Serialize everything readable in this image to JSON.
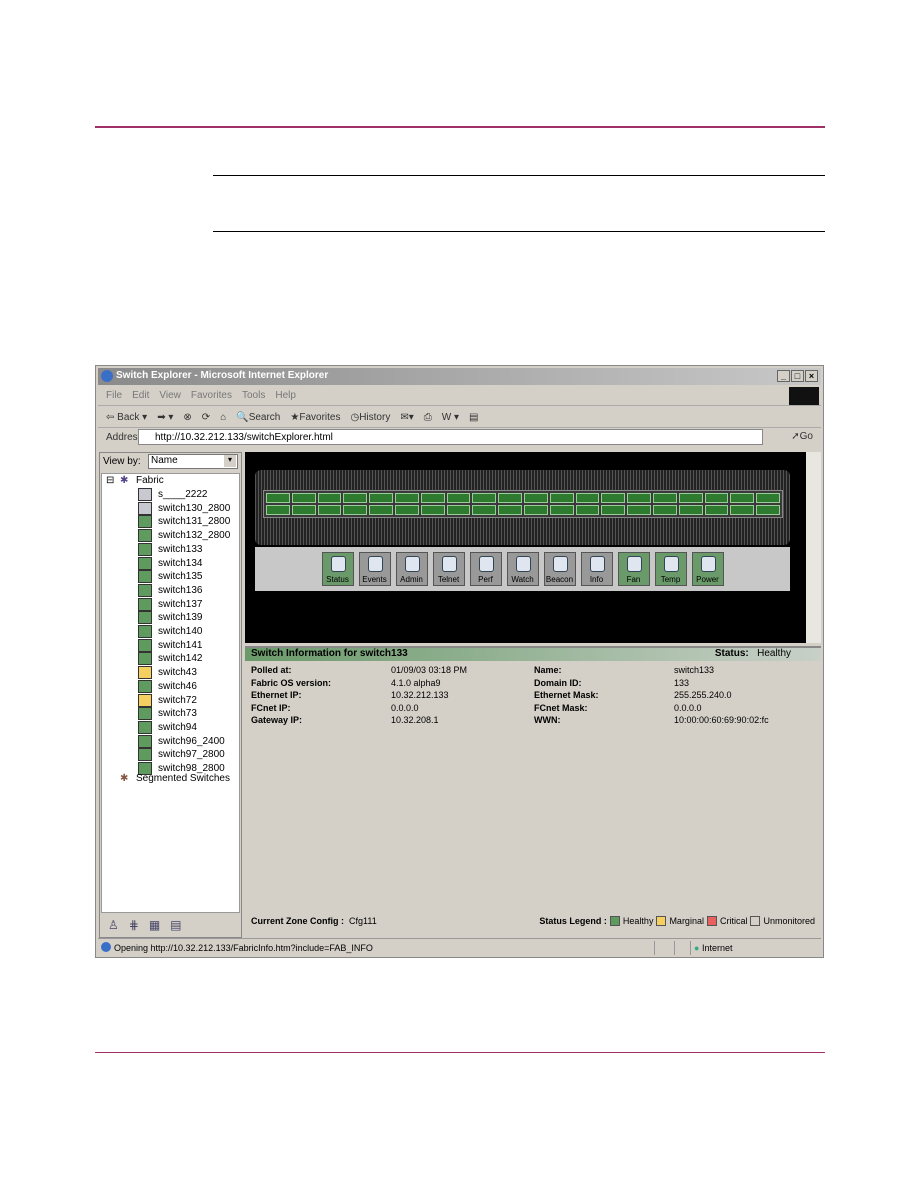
{
  "window": {
    "title": "Switch Explorer - Microsoft Internet Explorer"
  },
  "menu": [
    "File",
    "Edit",
    "View",
    "Favorites",
    "Tools",
    "Help"
  ],
  "toolbar": {
    "back": "Back",
    "search": "Search",
    "favorites": "Favorites",
    "history": "History"
  },
  "address": {
    "label": "Address",
    "url": "http://10.32.212.133/switchExplorer.html",
    "go": "Go"
  },
  "left": {
    "view_by_label": "View by:",
    "view_by_value": "Name",
    "root": "Fabric",
    "switches": [
      {
        "name": "s____2222",
        "status": "unmonitored"
      },
      {
        "name": "switch130_2800",
        "status": "unmonitored"
      },
      {
        "name": "switch131_2800",
        "status": "healthy"
      },
      {
        "name": "switch132_2800",
        "status": "healthy"
      },
      {
        "name": "switch133",
        "status": "healthy"
      },
      {
        "name": "switch134",
        "status": "healthy"
      },
      {
        "name": "switch135",
        "status": "healthy"
      },
      {
        "name": "switch136",
        "status": "healthy"
      },
      {
        "name": "switch137",
        "status": "healthy"
      },
      {
        "name": "switch139",
        "status": "healthy"
      },
      {
        "name": "switch140",
        "status": "healthy"
      },
      {
        "name": "switch141",
        "status": "healthy"
      },
      {
        "name": "switch142",
        "status": "healthy"
      },
      {
        "name": "switch43",
        "status": "marginal"
      },
      {
        "name": "switch46",
        "status": "healthy"
      },
      {
        "name": "switch72",
        "status": "marginal"
      },
      {
        "name": "switch73",
        "status": "healthy"
      },
      {
        "name": "switch94",
        "status": "healthy"
      },
      {
        "name": "switch96_2400",
        "status": "healthy"
      },
      {
        "name": "switch97_2800",
        "status": "healthy"
      },
      {
        "name": "switch98_2800",
        "status": "healthy"
      }
    ],
    "segmented": "Segmented Switches"
  },
  "switch_buttons": [
    {
      "label": "Status",
      "active": true
    },
    {
      "label": "Events",
      "active": false
    },
    {
      "label": "Admin",
      "active": false
    },
    {
      "label": "Telnet",
      "active": false
    },
    {
      "label": "Perf",
      "active": false
    },
    {
      "label": "Watch",
      "active": false
    },
    {
      "label": "Beacon",
      "active": false
    },
    {
      "label": "Info",
      "active": false
    },
    {
      "label": "Fan",
      "active": true
    },
    {
      "label": "Temp",
      "active": true
    },
    {
      "label": "Power",
      "active": true
    }
  ],
  "info": {
    "title": "Switch Information for switch133",
    "status_label": "Status:",
    "status_value": "Healthy",
    "left_fields": [
      [
        "Polled at:",
        "01/09/03 03:18 PM"
      ],
      [
        "Fabric OS version:",
        "4.1.0 alpha9"
      ],
      [
        "Ethernet IP:",
        "10.32.212.133"
      ],
      [
        "FCnet IP:",
        "0.0.0.0"
      ],
      [
        "Gateway IP:",
        "10.32.208.1"
      ]
    ],
    "right_fields": [
      [
        "Name:",
        "switch133"
      ],
      [
        "Domain ID:",
        "133"
      ],
      [
        "Ethernet Mask:",
        "255.255.240.0"
      ],
      [
        "FCnet Mask:",
        "0.0.0.0"
      ],
      [
        "WWN:",
        "10:00:00:60:69:90:02:fc"
      ]
    ],
    "zone_label": "Current Zone Config :",
    "zone_value": "Cfg111",
    "legend_label": "Status Legend :",
    "legend": [
      {
        "label": "Healthy",
        "color": "#5f9a5f"
      },
      {
        "label": "Marginal",
        "color": "#f5d060"
      },
      {
        "label": "Critical",
        "color": "#e86060"
      },
      {
        "label": "Unmonitored",
        "color": "#d4d0c8"
      }
    ]
  },
  "statusbar": {
    "text": "Opening http://10.32.212.133/FabricInfo.htm?include=FAB_INFO",
    "zone": "Internet"
  },
  "colors": {
    "rule": "#a0306a",
    "healthy": "#5f9a5f",
    "marginal": "#f5d060",
    "unmonitored": "#c8c8d0"
  }
}
